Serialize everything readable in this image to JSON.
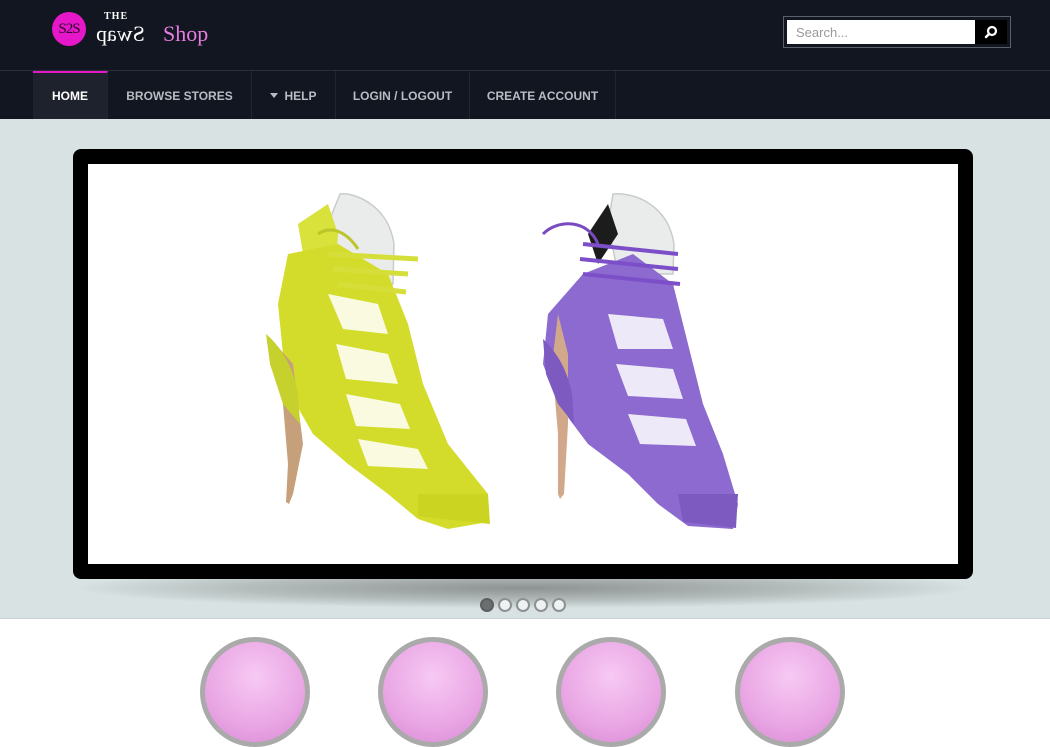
{
  "header": {
    "logo": {
      "mark": "S2S",
      "the": "THE",
      "swap": "Swap",
      "shop": "Shop"
    },
    "search": {
      "placeholder": "Search...",
      "button_icon": "search-icon"
    }
  },
  "nav": {
    "items": [
      {
        "label": "HOME",
        "active": true
      },
      {
        "label": "BROWSE STORES"
      },
      {
        "label": "HELP",
        "icon": "caret-down-icon"
      },
      {
        "label": "LOGIN / LOGOUT"
      },
      {
        "label": "CREATE ACCOUNT"
      }
    ]
  },
  "slider": {
    "image": "two lace-up high-heel sandals, one yellow-green and one purple",
    "dots": 5,
    "active_dot": 1
  },
  "colors": {
    "header_bg": "#121620",
    "accent": "#e617c9",
    "hero_bg": "#d8e2e2",
    "logo_shop": "#e77de0"
  }
}
